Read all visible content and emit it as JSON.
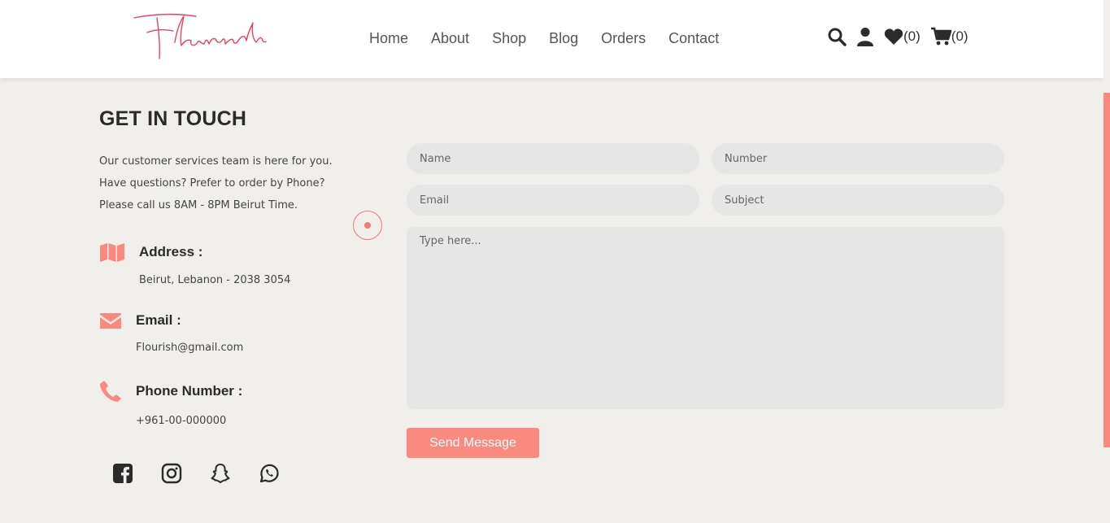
{
  "brand": {
    "logo_text": "Flourish",
    "accent": "#fa8a80",
    "logo_color": "#e8435c"
  },
  "nav": {
    "items": [
      "Home",
      "About",
      "Shop",
      "Blog",
      "Orders",
      "Contact"
    ]
  },
  "header_icons": {
    "wishlist_count": "(0)",
    "cart_count": "(0)"
  },
  "contact": {
    "title": "GET IN TOUCH",
    "intro": [
      "Our customer services team is here for you.",
      "Have questions? Prefer to order by Phone?",
      "Please call us 8AM - 8PM Beirut Time."
    ],
    "address": {
      "label": "Address :",
      "value": "Beirut, Lebanon - 2038 3054",
      "icon": "map-icon"
    },
    "email": {
      "label": "Email :",
      "value": "Flourish@gmail.com",
      "icon": "envelope-icon"
    },
    "phone": {
      "label": "Phone Number :",
      "value": "+961-00-000000",
      "icon": "phone-icon"
    }
  },
  "social": [
    "facebook-icon",
    "instagram-icon",
    "snapchat-icon",
    "whatsapp-icon"
  ],
  "form": {
    "name_placeholder": "Name",
    "number_placeholder": "Number",
    "email_placeholder": "Email",
    "subject_placeholder": "Subject",
    "message_placeholder": "Type here...",
    "send_label": "Send Message"
  }
}
